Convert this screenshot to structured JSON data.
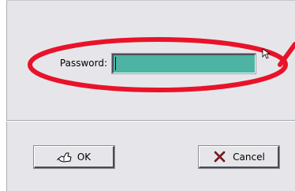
{
  "dialog": {
    "password_label": "Password:",
    "password_value": ""
  },
  "buttons": {
    "ok_label": "OK",
    "cancel_label": "Cancel",
    "ok_icon": "ok-hand-icon",
    "cancel_icon": "cancel-x-icon"
  },
  "colors": {
    "dialog_bg": "#e6e6ea",
    "field_bg": "#4db3a3",
    "annotation": "#e8132a"
  }
}
